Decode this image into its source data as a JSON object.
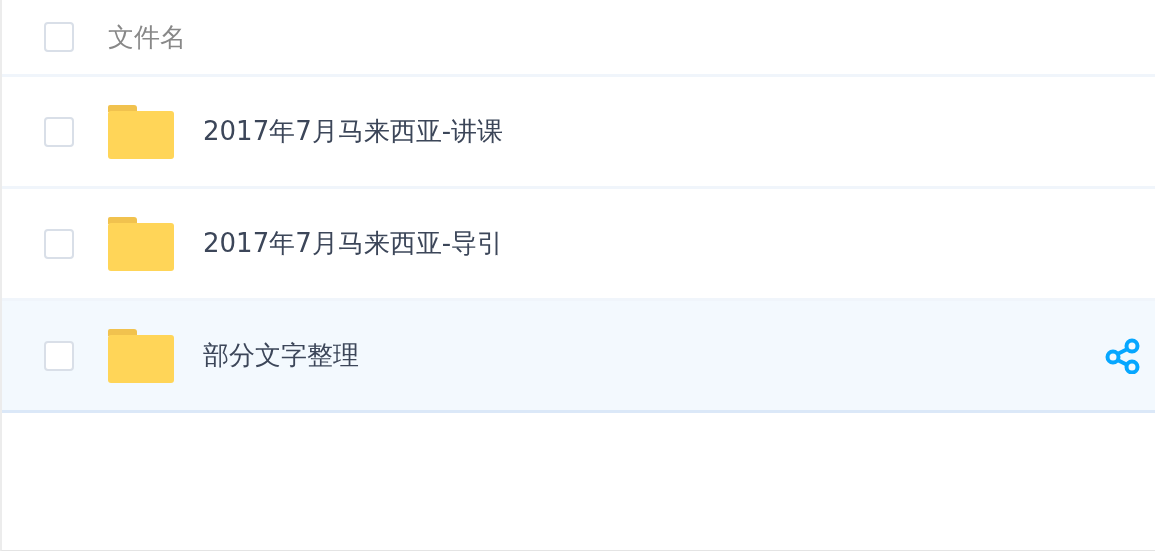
{
  "header": {
    "checked": false,
    "label": "文件名"
  },
  "files": [
    {
      "name": "2017年7月马来西亚-讲课",
      "checked": false,
      "selected": false
    },
    {
      "name": "2017年7月马来西亚-导引",
      "checked": false,
      "selected": false
    },
    {
      "name": "部分文字整理",
      "checked": false,
      "selected": true
    }
  ]
}
